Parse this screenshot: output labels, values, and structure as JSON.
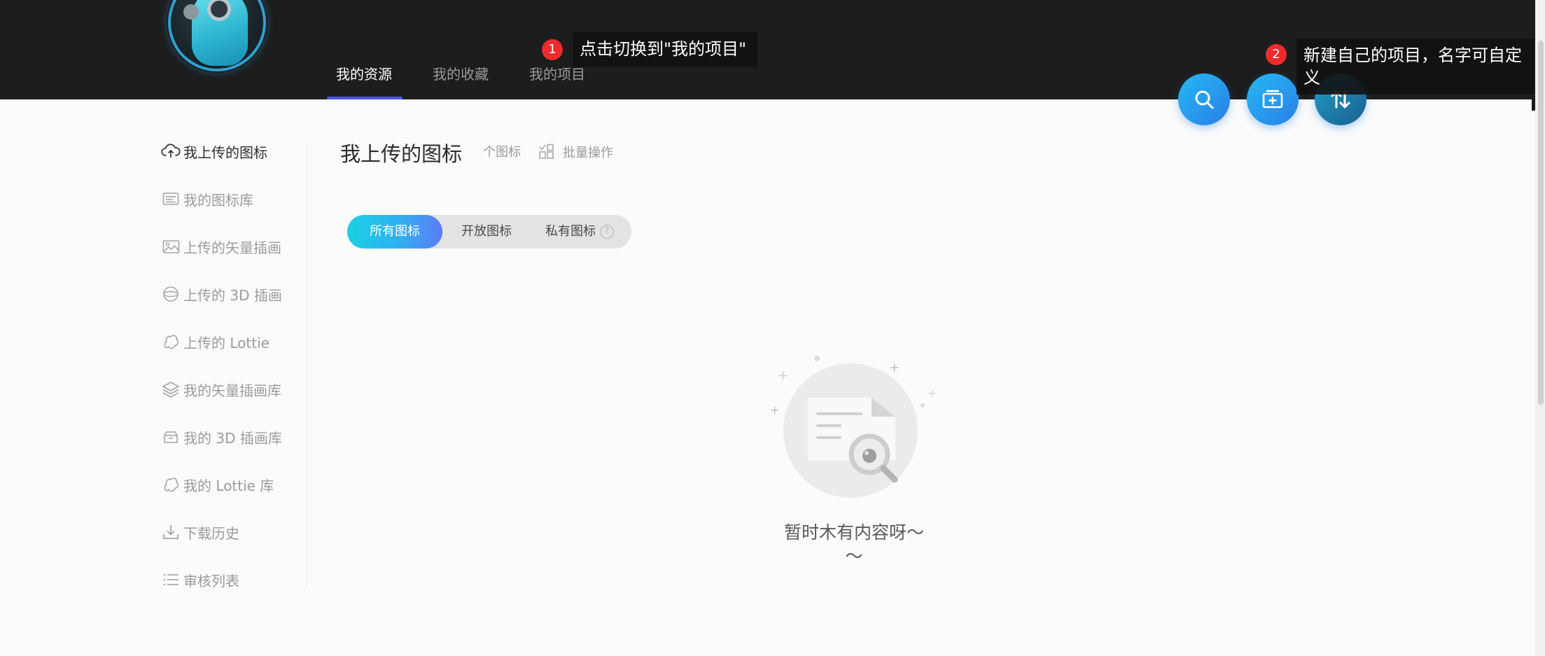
{
  "header": {
    "tabs": [
      {
        "label": "我的资源",
        "active": true
      },
      {
        "label": "我的收藏",
        "active": false
      },
      {
        "label": "我的项目",
        "active": false
      }
    ],
    "fabs": [
      {
        "icon": "search-icon"
      },
      {
        "icon": "new-project-icon"
      },
      {
        "icon": "sort-icon"
      }
    ]
  },
  "tooltips": [
    {
      "badge": "1",
      "text": "点击切换到\"我的项目\""
    },
    {
      "badge": "2",
      "text": "新建自己的项目，名字可自定义"
    }
  ],
  "sidebar": {
    "items": [
      {
        "label": "我上传的图标",
        "icon": "cloud-upload-icon",
        "active": true
      },
      {
        "label": "我的图标库",
        "icon": "icon-library-icon",
        "active": false
      },
      {
        "label": "上传的矢量插画",
        "icon": "image-icon",
        "active": false
      },
      {
        "label": "上传的 3D 插画",
        "icon": "sphere-icon",
        "active": false
      },
      {
        "label": "上传的 Lottie",
        "icon": "lottie-icon",
        "active": false
      },
      {
        "label": "我的矢量插画库",
        "icon": "layers-icon",
        "active": false
      },
      {
        "label": "我的 3D 插画库",
        "icon": "box-icon",
        "active": false
      },
      {
        "label": "我的 Lottie 库",
        "icon": "lottie-icon",
        "active": false
      },
      {
        "label": "下载历史",
        "icon": "download-icon",
        "active": false
      },
      {
        "label": "审核列表",
        "icon": "list-icon",
        "active": false
      }
    ]
  },
  "main": {
    "title": "我上传的图标",
    "count_label": "个图标",
    "batch_label": "批量操作",
    "filters": [
      {
        "label": "所有图标",
        "active": true
      },
      {
        "label": "开放图标",
        "active": false
      },
      {
        "label": "私有图标",
        "active": false,
        "help": "?"
      }
    ],
    "empty_text": "暂时木有内容呀～～"
  },
  "colors": {
    "header_bg": "#1d1d1d",
    "accent": "#4b55e8",
    "fab_gradient_start": "#25b8f2",
    "fab_gradient_end": "#2a7fe8",
    "badge": "#ef2b2b"
  }
}
